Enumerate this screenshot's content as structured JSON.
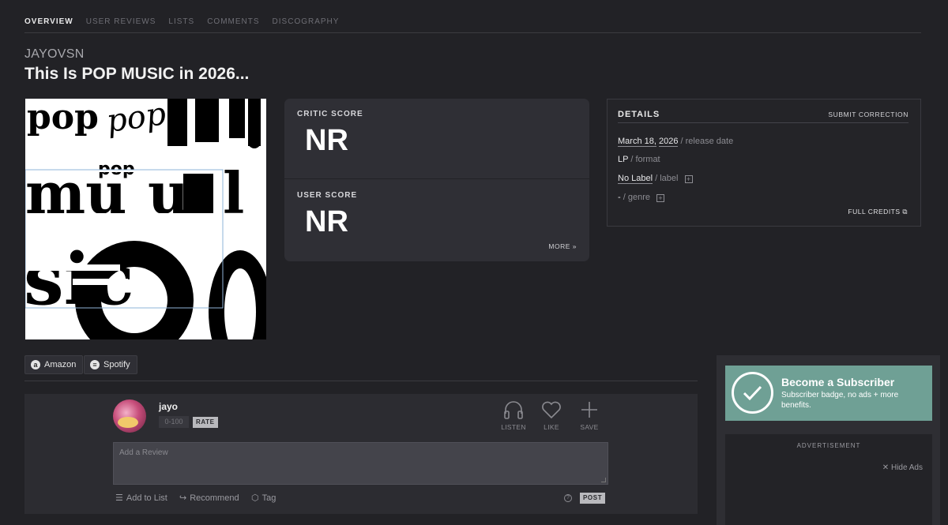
{
  "nav": {
    "tabs": [
      "OVERVIEW",
      "USER REVIEWS",
      "LISTS",
      "COMMENTS",
      "DISCOGRAPHY"
    ],
    "active": "OVERVIEW"
  },
  "album": {
    "artist": "JAYOVSN",
    "title": "This Is POP MUSIC in 2026..."
  },
  "scores": {
    "critic_label": "CRITIC SCORE",
    "critic_value": "NR",
    "user_label": "USER SCORE",
    "user_value": "NR",
    "more": "MORE"
  },
  "details": {
    "title": "DETAILS",
    "submit": "SUBMIT CORRECTION",
    "release_month_day": "March 18,",
    "release_year": "2026",
    "release_suffix": "/ release date",
    "format": "LP",
    "format_suffix": "/ format",
    "label": "No Label",
    "label_suffix": "/ label",
    "genre": "-",
    "genre_suffix": "/ genre",
    "full_credits": "FULL CREDITS"
  },
  "stores": {
    "amazon": "Amazon",
    "spotify": "Spotify"
  },
  "review": {
    "username": "jayo",
    "rate_placeholder": "0-100",
    "rate_button": "RATE",
    "listen": "LISTEN",
    "like": "LIKE",
    "save": "SAVE",
    "textarea_placeholder": "Add a Review",
    "add_to_list": "Add to List",
    "recommend": "Recommend",
    "tag": "Tag",
    "post": "POST"
  },
  "sidebar": {
    "sub_title": "Become a Subscriber",
    "sub_desc": "Subscriber badge, no ads + more benefits.",
    "ad_label": "ADVERTISEMENT",
    "hide_ads": "Hide Ads"
  },
  "colors": {
    "background": "#222226",
    "panel": "#2f2f35",
    "subscriber": "#6fa095"
  },
  "cover_art_text": [
    "pop",
    "pop",
    "music",
    "00"
  ]
}
